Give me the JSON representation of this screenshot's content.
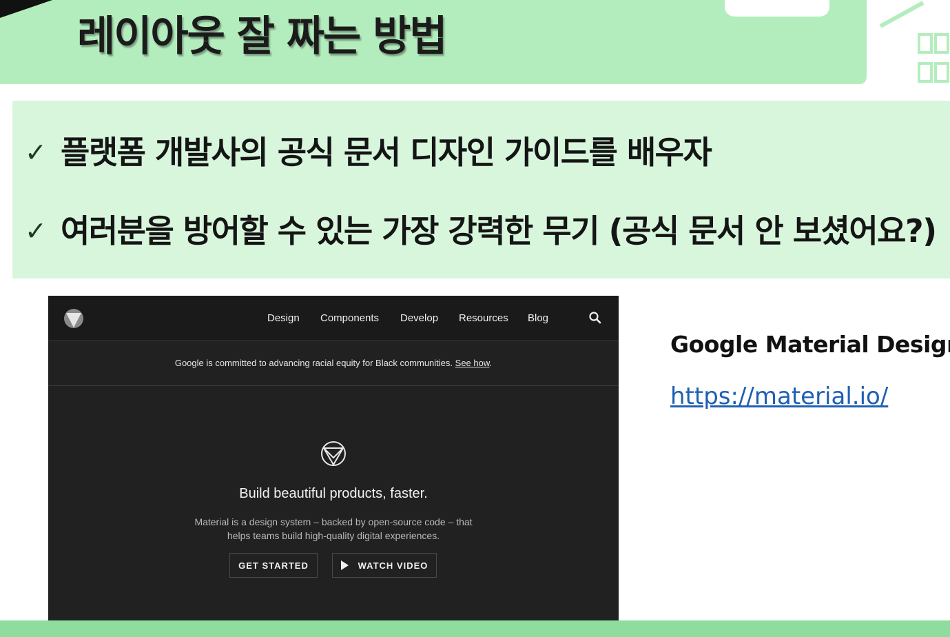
{
  "slide": {
    "title": "레이아웃 잘 짜는 방법",
    "bullets": [
      {
        "check": "✓",
        "text": "플랫폼 개발사의 공식 문서 디자인 가이드를 배우자"
      },
      {
        "check": "✓",
        "text": "여러분을 방어할 수 있는 가장 강력한 무기 (공식 문서 안 보셨어요?)"
      }
    ],
    "reference": {
      "title": "Google Material Design",
      "link": "https://material.io/"
    }
  },
  "material_site": {
    "nav": [
      "Design",
      "Components",
      "Develop",
      "Resources",
      "Blog"
    ],
    "announcement": {
      "text": "Google is committed to advancing racial equity for Black communities.",
      "link": "See how"
    },
    "hero": {
      "title": "Build beautiful products, faster.",
      "description_line1": "Material is a design system – backed by open-source code – that",
      "description_line2": "helps teams build high-quality digital experiences.",
      "primary_button": "GET STARTED",
      "secondary_button": "WATCH VIDEO"
    }
  },
  "colors": {
    "header_green": "#b4edbd",
    "panel_green": "#d8f6dc",
    "site_dark": "#212121",
    "link_blue": "#1e5fb4"
  }
}
